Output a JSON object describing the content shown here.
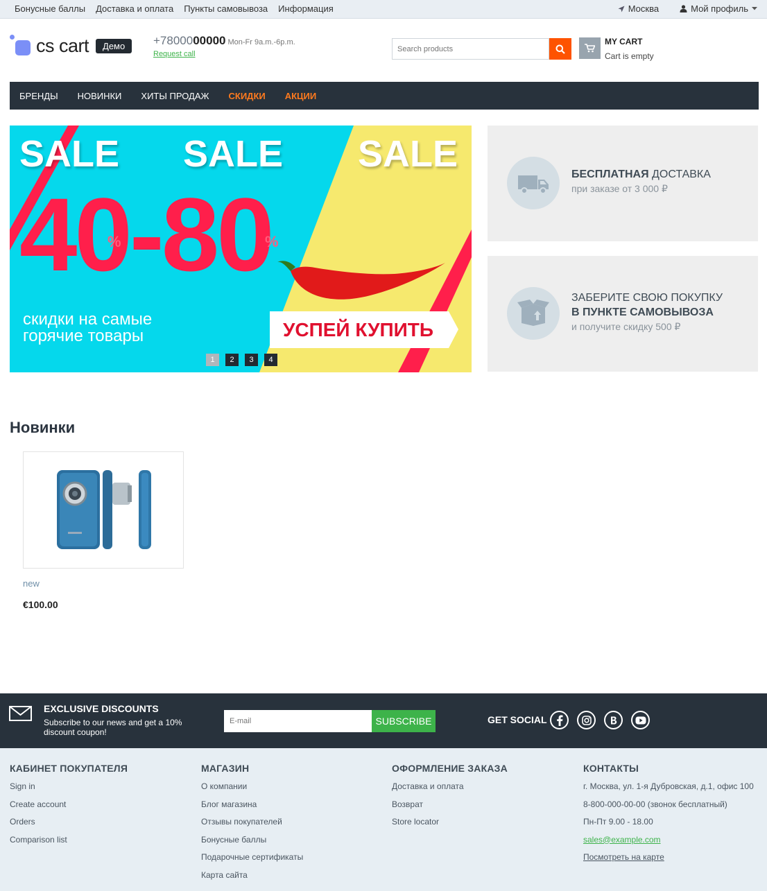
{
  "topbar": {
    "links": [
      "Бонусные баллы",
      "Доставка и оплата",
      "Пункты самовывоза",
      "Информация"
    ],
    "location": "Москва",
    "profile": "Мой профиль"
  },
  "header": {
    "logo_text": "cs cart",
    "demo_badge": "Демо",
    "phone_prefix": "+78000",
    "phone_main": "00000",
    "phone_hours": "Mon-Fr 9a.m.-6p.m.",
    "request_call": "Request call",
    "search_placeholder": "Search products",
    "cart_title": "MY CART",
    "cart_status": "Cart is empty"
  },
  "nav": {
    "items": [
      {
        "label": "БРЕНДЫ"
      },
      {
        "label": "НОВИНКИ"
      },
      {
        "label": "ХИТЫ ПРОДАЖ"
      },
      {
        "label": "СКИДКИ"
      },
      {
        "label": "АКЦИИ"
      }
    ]
  },
  "banner": {
    "sale_word": "SALE",
    "discount": "40-80",
    "percent": "%",
    "subtitle_line1": "скидки на самые",
    "subtitle_line2": "горячие товары",
    "cta": "УСПЕЙ КУПИТЬ",
    "pages": [
      "1",
      "2",
      "3",
      "4"
    ],
    "active_page": "1"
  },
  "promos": [
    {
      "title_bold": "БЕСПЛАТНАЯ",
      "title_rest": " ДОСТАВКА",
      "subtitle": "при заказе от 3 000 ₽"
    },
    {
      "line1": "ЗАБЕРИТЕ СВОЮ ПОКУПКУ",
      "line2": "В ПУНКТЕ САМОВЫВОЗА",
      "subtitle": "и получите скидку 500 ₽"
    }
  ],
  "new_products": {
    "title": "Новинки",
    "items": [
      {
        "name": "new",
        "price": "€100.00"
      }
    ]
  },
  "subscribe": {
    "title": "EXCLUSIVE DISCOUNTS",
    "text": "Subscribe to our news and get a 10% discount coupon!",
    "email_placeholder": "E-mail",
    "button": "SUBSCRIBE",
    "social_title": "GET SOCIAL"
  },
  "footer": {
    "columns": [
      {
        "title": "КАБИНЕТ ПОКУПАТЕЛЯ",
        "links": [
          "Sign in",
          "Create account",
          "Orders",
          "Comparison list"
        ]
      },
      {
        "title": "МАГАЗИН",
        "links": [
          "О компании",
          "Блог магазина",
          "Отзывы покупателей",
          "Бонусные баллы",
          "Подарочные сертификаты",
          "Карта сайта"
        ]
      },
      {
        "title": "ОФОРМЛЕНИЕ ЗАКАЗА",
        "links": [
          "Доставка и оплата",
          "Возврат",
          "Store locator"
        ]
      },
      {
        "title": "КОНТАКТЫ",
        "links": [
          "г. Москва, ул. 1-я Дубровская, д.1, офис 100",
          "8-800-000-00-00 (звонок бесплатный)",
          "Пн-Пт 9.00 - 18.00",
          "sales@example.com",
          "Посмотреть на карте"
        ]
      }
    ]
  },
  "colors": {
    "accent_orange": "#fe5300",
    "nav_bg": "#28323c",
    "green": "#3db34a",
    "banner_cyan": "#05d8ec",
    "banner_yellow": "#f6e96e",
    "banner_red": "#ff1f4b"
  }
}
